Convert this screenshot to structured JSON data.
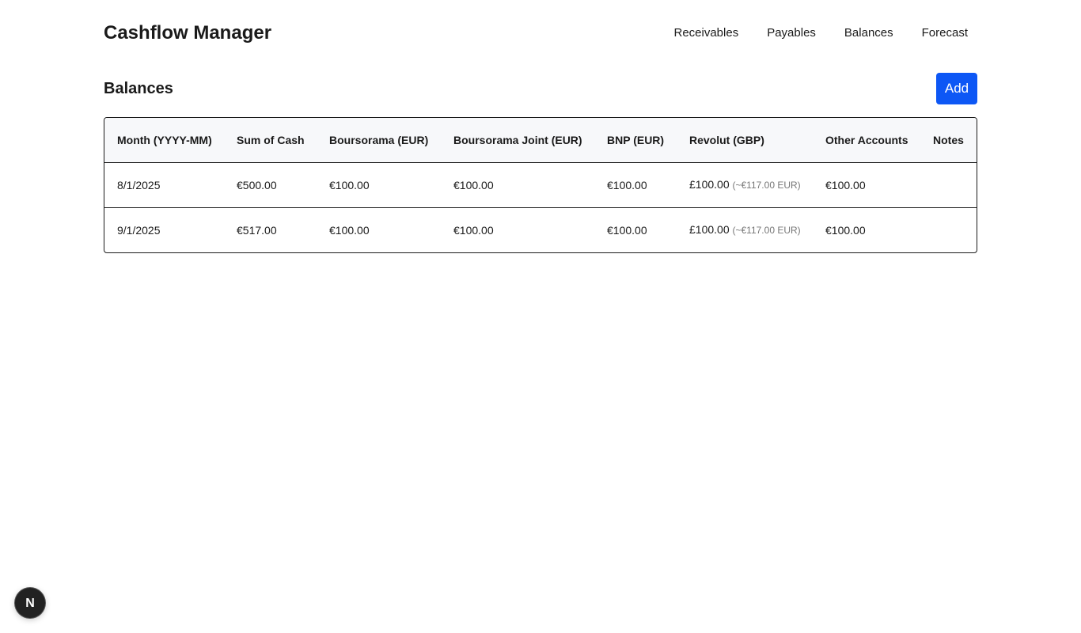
{
  "app": {
    "title": "Cashflow Manager"
  },
  "nav": {
    "items": [
      {
        "label": "Receivables"
      },
      {
        "label": "Payables"
      },
      {
        "label": "Balances"
      },
      {
        "label": "Forecast"
      }
    ]
  },
  "page": {
    "title": "Balances",
    "add_label": "Add"
  },
  "table": {
    "headers": [
      "Month (YYYY-MM)",
      "Sum of Cash",
      "Boursorama (EUR)",
      "Boursorama Joint (EUR)",
      "BNP (EUR)",
      "Revolut (GBP)",
      "Other Accounts",
      "Notes"
    ],
    "rows": [
      {
        "month": "8/1/2025",
        "sum": "€500.00",
        "boursorama": "€100.00",
        "boursorama_joint": "€100.00",
        "bnp": "€100.00",
        "revolut": "£100.00",
        "revolut_eur": "(~€117.00 EUR)",
        "other": "€100.00",
        "notes": ""
      },
      {
        "month": "9/1/2025",
        "sum": "€517.00",
        "boursorama": "€100.00",
        "boursorama_joint": "€100.00",
        "bnp": "€100.00",
        "revolut": "£100.00",
        "revolut_eur": "(~€117.00 EUR)",
        "other": "€100.00",
        "notes": ""
      }
    ]
  },
  "badge": {
    "icon": "nextjs-logo-icon",
    "letter": "N"
  },
  "colors": {
    "accent": "#0d57f5",
    "header_bg": "#f7f8fa"
  }
}
